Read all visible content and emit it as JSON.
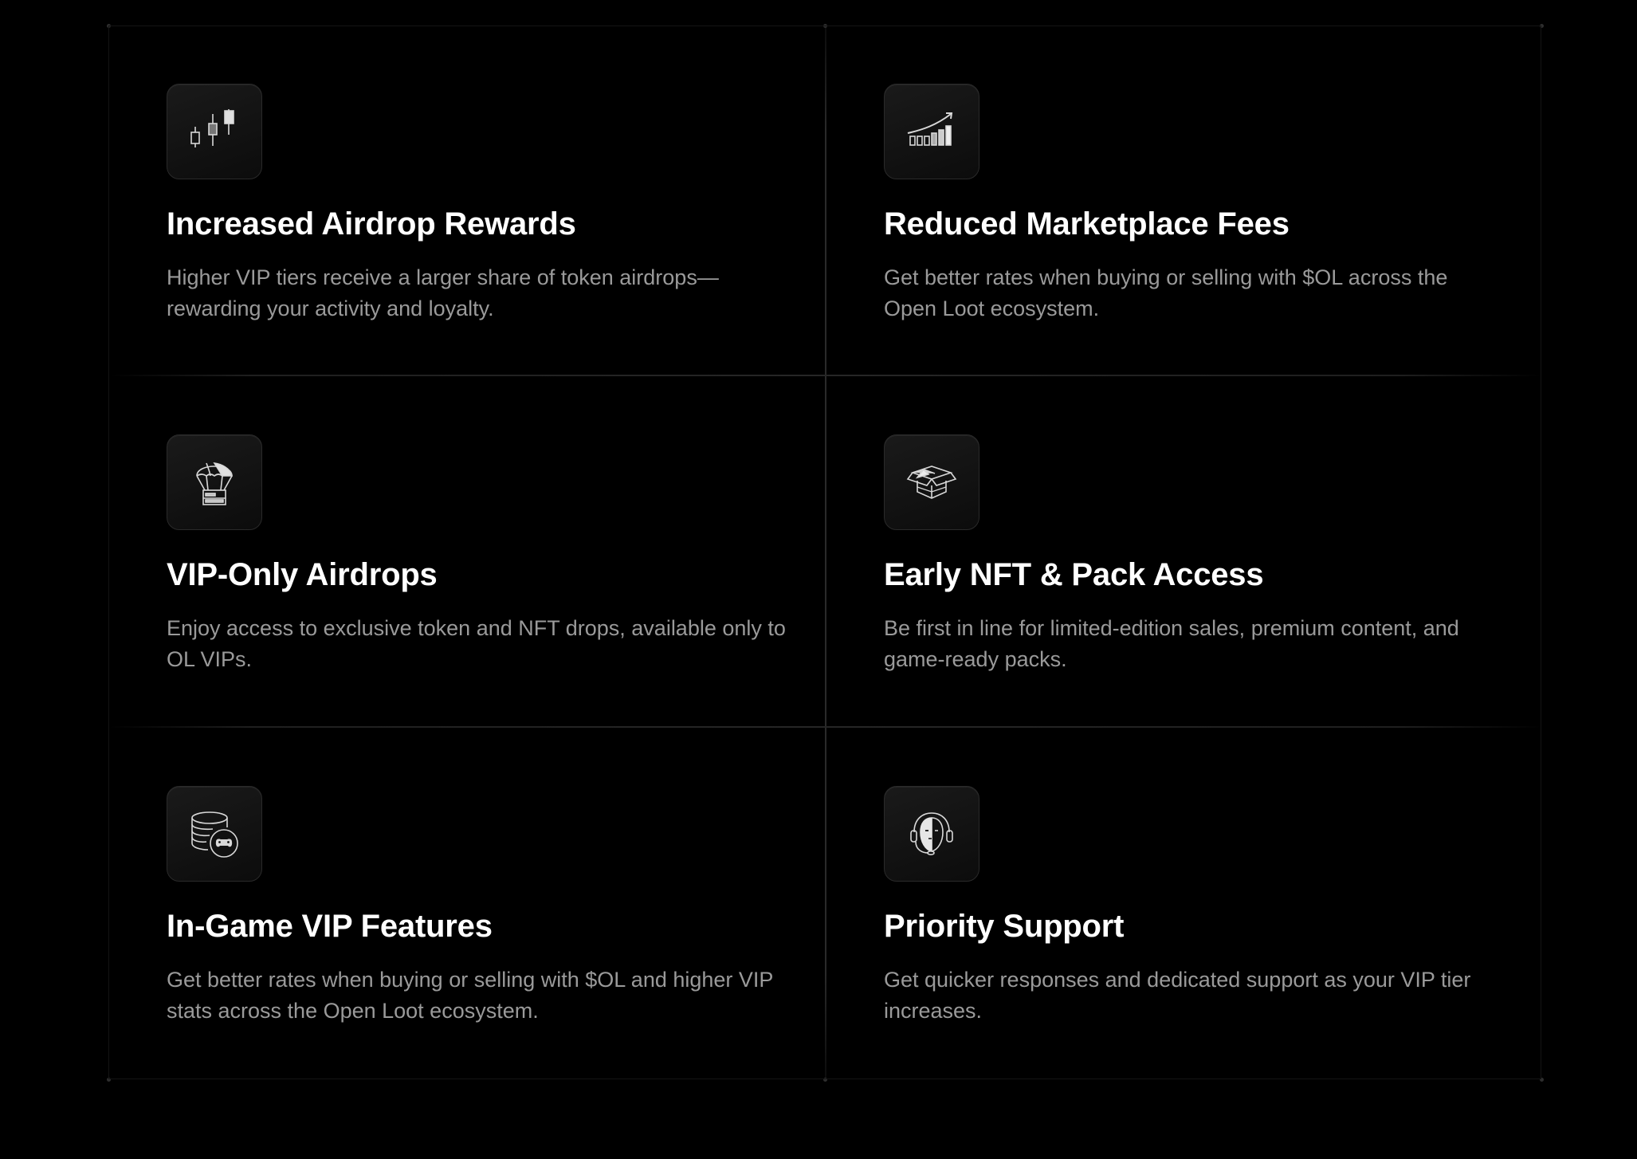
{
  "features": [
    {
      "icon": "candlestick-chart-icon",
      "title": "Increased Airdrop Rewards",
      "description": "Higher VIP tiers receive a larger share of token airdrops—rewarding your activity and loyalty."
    },
    {
      "icon": "growth-bars-arrow-icon",
      "title": "Reduced Marketplace Fees",
      "description": "Get better rates when buying or selling with $OL across the Open Loot ecosystem."
    },
    {
      "icon": "parachute-crate-icon",
      "title": "VIP-Only Airdrops",
      "description": "Enjoy access to exclusive token and NFT drops, available only to OL VIPs."
    },
    {
      "icon": "open-box-icon",
      "title": "Early NFT & Pack Access",
      "description": "Be first in line for limited-edition sales, premium content, and game-ready packs."
    },
    {
      "icon": "coins-gamepad-icon",
      "title": "In-Game VIP Features",
      "description": "Get better rates when buying or selling with $OL and higher VIP stats across the Open Loot ecosystem."
    },
    {
      "icon": "support-headset-icon",
      "title": "Priority Support",
      "description": "Get quicker responses and dedicated support as your VIP tier increases."
    }
  ]
}
